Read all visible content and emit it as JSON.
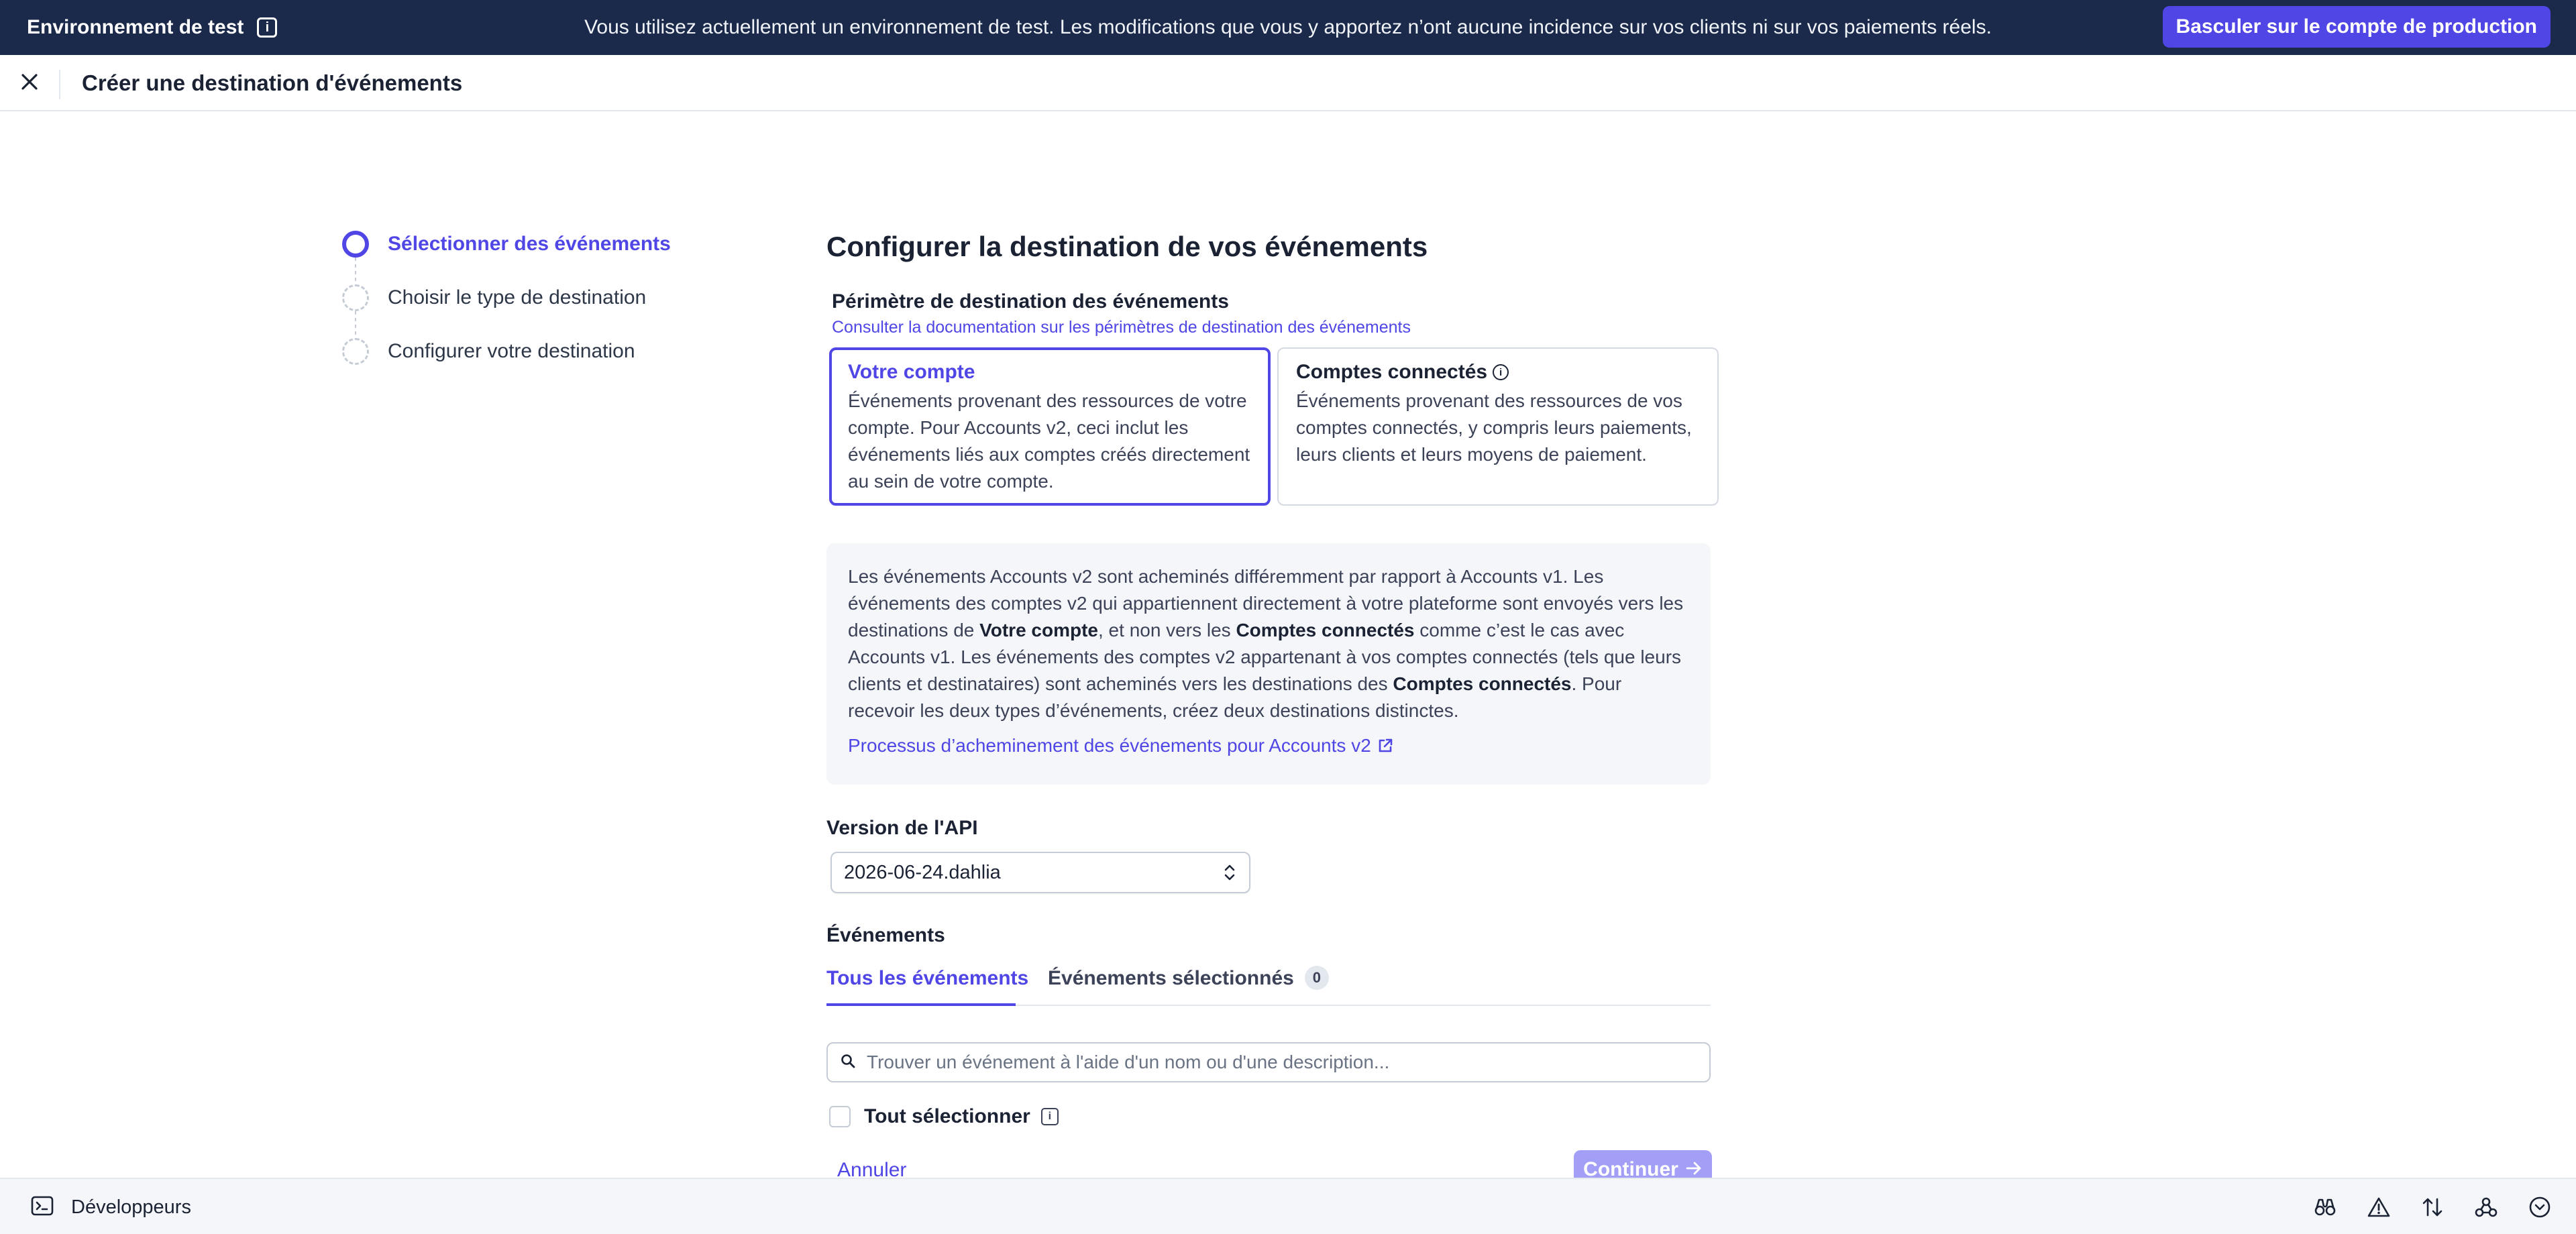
{
  "banner": {
    "env_label": "Environnement de test",
    "message": "Vous utilisez actuellement un environnement de test. Les modifications que vous y apportez n’ont aucune incidence sur vos clients ni sur vos paiements réels.",
    "prod_button": "Basculer sur le compte de production"
  },
  "header": {
    "title": "Créer une destination d'événements"
  },
  "stepper": {
    "steps": [
      {
        "label": "Sélectionner des événements",
        "state": "active"
      },
      {
        "label": "Choisir le type de destination",
        "state": "pending"
      },
      {
        "label": "Configurer votre destination",
        "state": "pending"
      }
    ]
  },
  "main": {
    "title": "Configurer la destination de vos événements",
    "scope": {
      "label": "Périmètre de destination des événements",
      "doc_link": "Consulter la documentation sur les périmètres de destination des événements",
      "options": [
        {
          "title": "Votre compte",
          "description": "Événements provenant des ressources de votre compte. Pour Accounts v2, ceci inclut les événements liés aux comptes créés directement au sein de votre compte.",
          "selected": true
        },
        {
          "title": "Comptes connectés",
          "description": "Événements provenant des ressources de vos comptes connectés, y compris leurs paiements, leurs clients et leurs moyens de paiement.",
          "selected": false
        }
      ]
    },
    "notice": {
      "p1": "Les événements Accounts v2 sont acheminés différemment par rapport à Accounts v1. Les événements des comptes v2 qui appartiennent directement à votre plateforme sont envoyés vers les destinations de ",
      "b1": "Votre compte",
      "p2": ", et non vers les ",
      "b2": "Comptes connectés",
      "p3": " comme c’est le cas avec Accounts v1. Les événements des comptes v2 appartenant à vos comptes connectés (tels que leurs clients et destinataires) sont acheminés vers les destinations des ",
      "b3": "Comptes connectés",
      "p4": ". Pour recevoir les deux types d’événements, créez deux destinations distinctes.",
      "link": "Processus d’acheminement des événements pour Accounts v2"
    },
    "api_version": {
      "label": "Version de l'API",
      "value": "2026-06-24.dahlia"
    },
    "events": {
      "label": "Événements",
      "tabs": [
        {
          "label": "Tous les événements",
          "active": true
        },
        {
          "label": "Événements sélectionnés",
          "count": "0",
          "active": false
        }
      ],
      "search_placeholder": "Trouver un événement à l'aide d'un nom ou d'une description...",
      "select_all": "Tout sélectionner"
    },
    "actions": {
      "cancel": "Annuler",
      "continue": "Continuer"
    }
  },
  "dev_bar": {
    "label": "Développeurs",
    "icons": [
      "terminal-icon",
      "binoculars-icon",
      "warning-icon",
      "transfer-arrows-icon",
      "webhook-icon",
      "chevron-down-circle-icon"
    ]
  },
  "colors": {
    "accent": "#5046e5",
    "banner_bg": "#1b2a4a",
    "continue_disabled": "#a39ff7"
  }
}
